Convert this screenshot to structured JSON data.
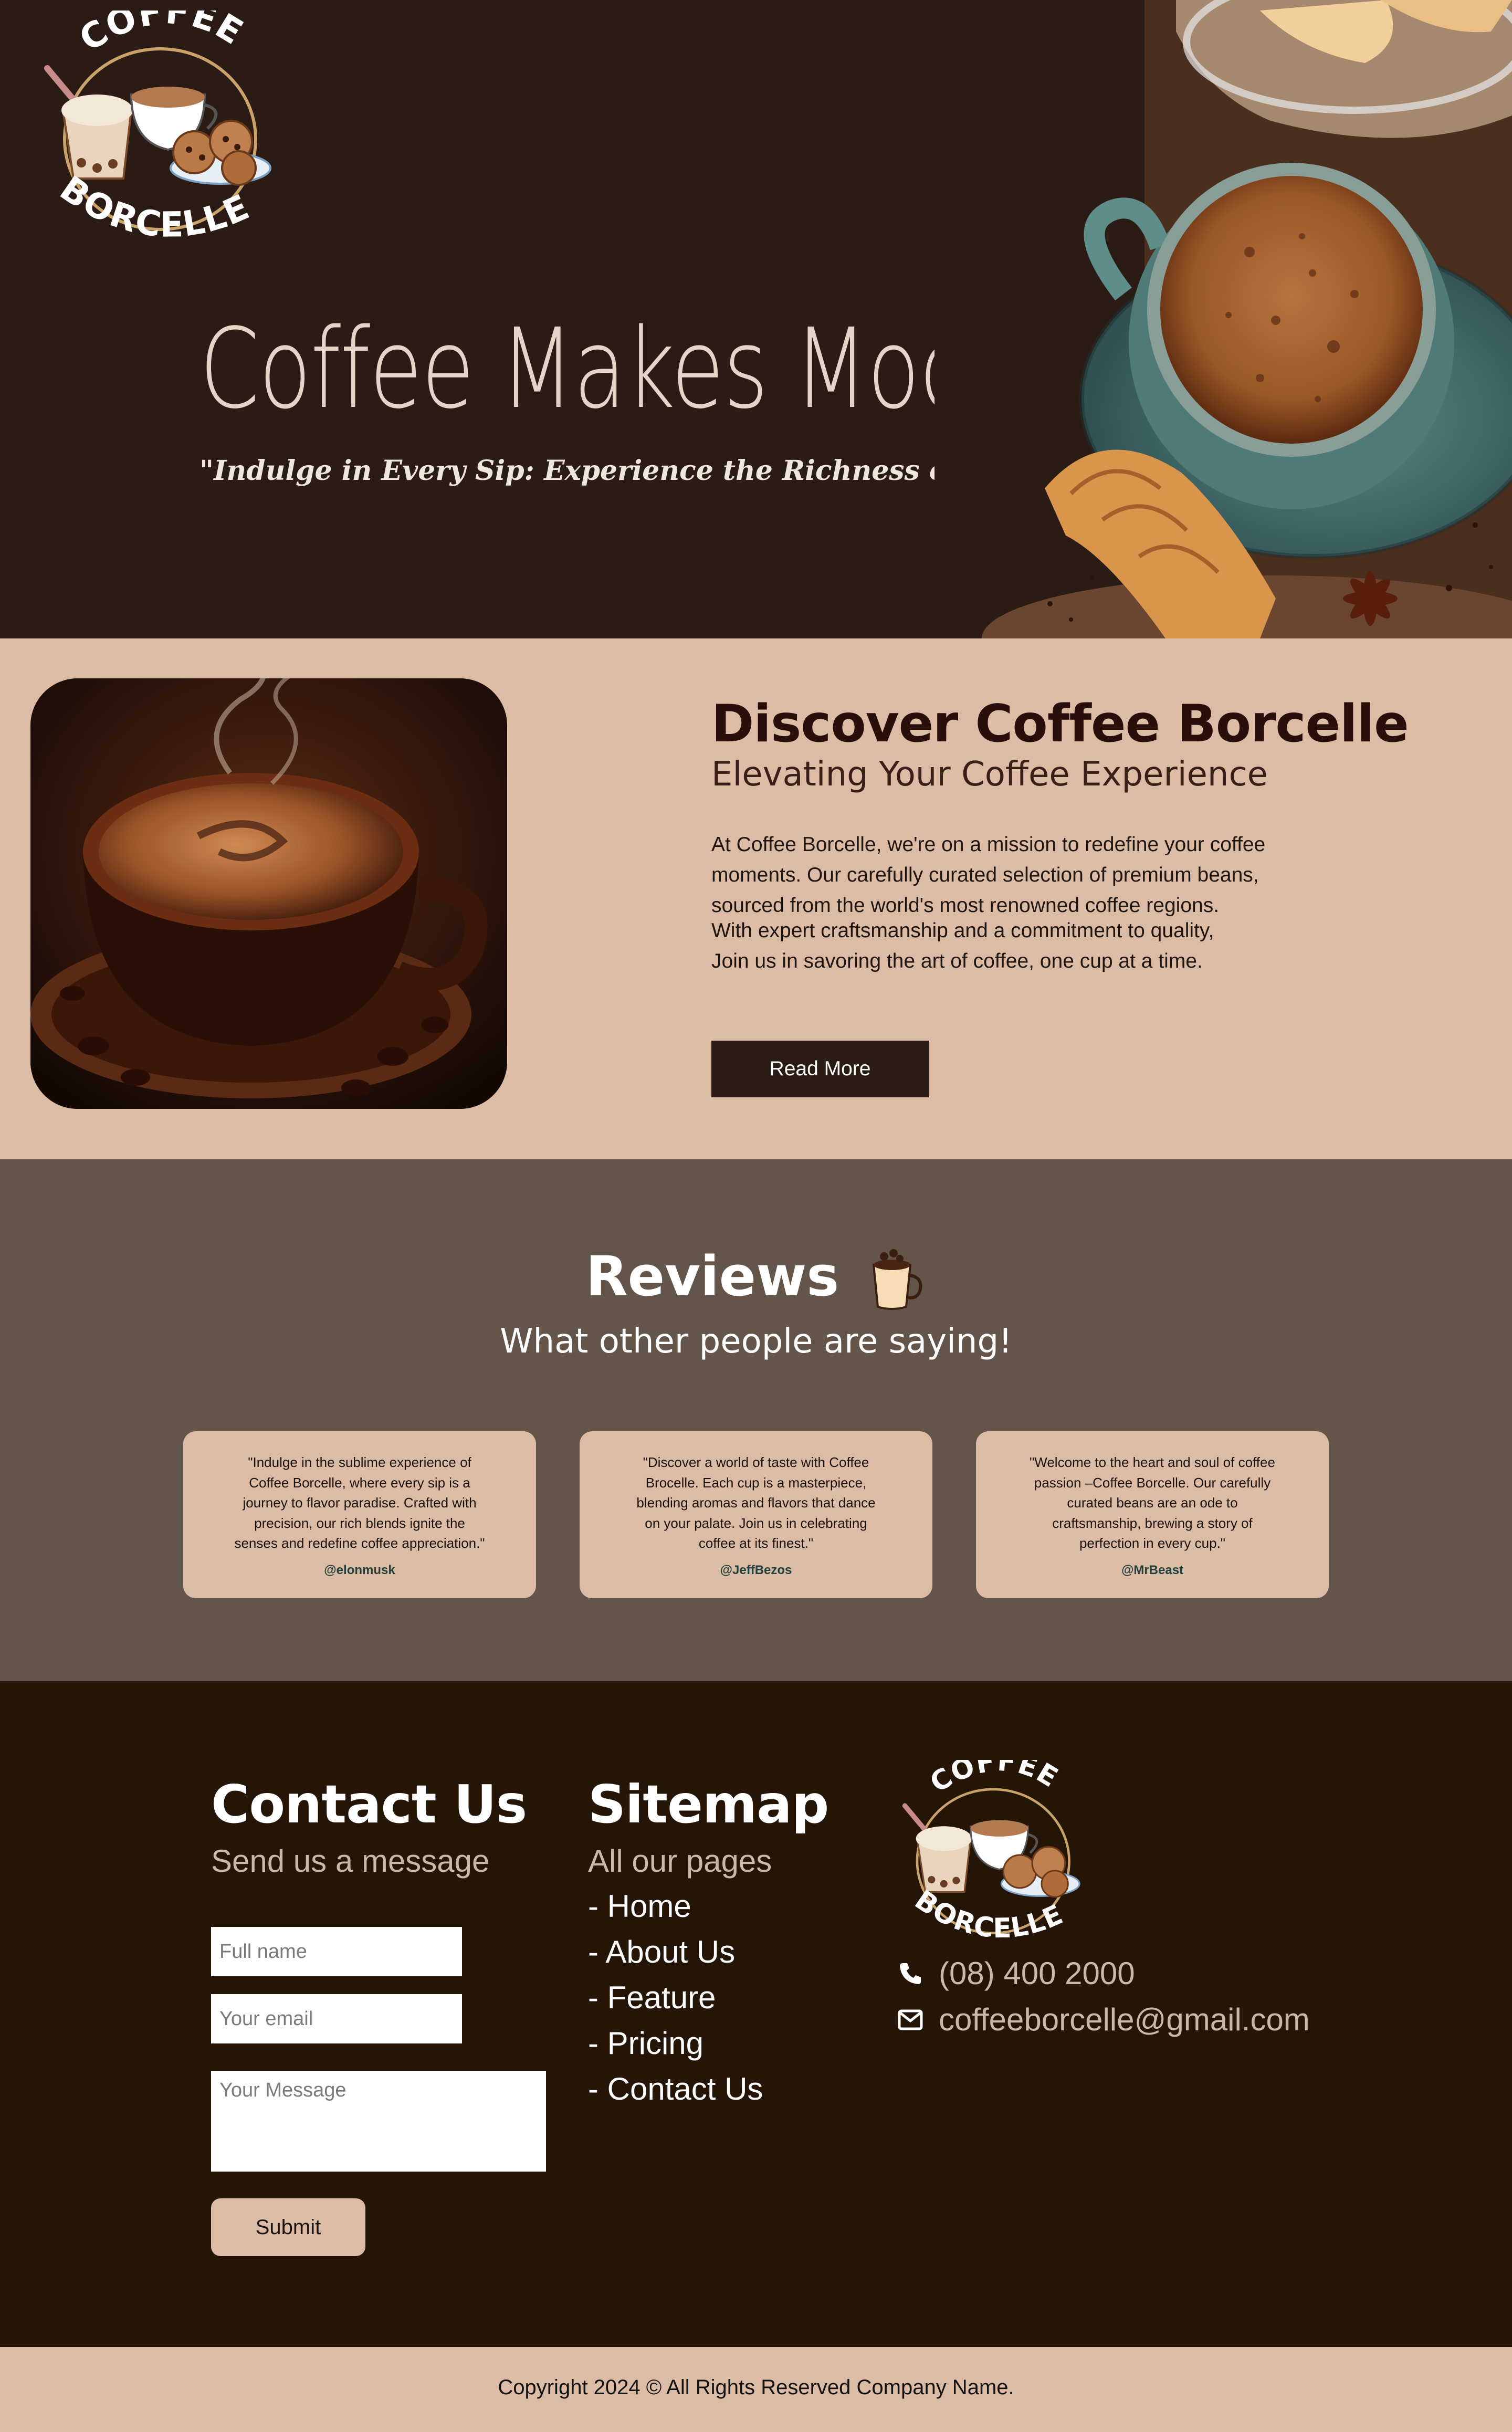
{
  "brand": {
    "logo_top": "COFFEE",
    "logo_bottom": "BORCELLE"
  },
  "hero": {
    "title": "Coffee Makes Mood",
    "subtitle": "\"Indulge in Every Sip: Experience the Richness of Coffee!\""
  },
  "about": {
    "title": "Discover Coffee Borcelle",
    "subtitle": "Elevating Your Coffee Experience",
    "para1_line1": "At Coffee Borcelle, we're on a mission to redefine your coffee",
    "para1_line2": "moments. Our carefully curated selection of premium beans,",
    "para1_line3": "sourced from the world's most renowned coffee regions.",
    "para2_line1": "With expert craftsmanship and a commitment to quality,",
    "para2_line2": "Join us in savoring the art of coffee, one cup at a time.",
    "button": "Read More"
  },
  "reviews": {
    "title": "Reviews",
    "subtitle": "What other people are saying!",
    "items": [
      {
        "lines": [
          "\"Indulge in the sublime experience of",
          "Coffee Borcelle, where every sip is a",
          "journey to flavor paradise. Crafted with",
          "precision, our rich blends ignite the",
          "senses and redefine coffee appreciation.\""
        ],
        "author": "@elonmusk"
      },
      {
        "lines": [
          "\"Discover a world of taste with Coffee",
          "Brocelle. Each cup is a masterpiece,",
          "blending aromas and flavors that dance",
          "on your palate. Join us in celebrating",
          "coffee at its finest.\""
        ],
        "author": "@JeffBezos"
      },
      {
        "lines": [
          "\"Welcome to the heart and soul of coffee",
          "passion –Coffee Borcelle. Our carefully",
          "curated beans are an ode to",
          "craftsmanship, brewing a story of",
          "perfection in every cup.\""
        ],
        "author": "@MrBeast"
      }
    ]
  },
  "contact": {
    "title": "Contact Us",
    "subtitle": "Send us a message",
    "name_placeholder": "Full name",
    "email_placeholder": "Your email",
    "message_placeholder": "Your Message",
    "submit": "Submit"
  },
  "sitemap": {
    "title": "Sitemap",
    "subtitle": "All our pages",
    "links": [
      "- Home",
      "- About Us",
      "- Feature",
      "- Pricing",
      "- Contact Us"
    ]
  },
  "info": {
    "phone": "(08) 400 2000",
    "email": "coffeeborcelle@gmail.com",
    "phone_icon": "phone-icon",
    "email_icon": "envelope-icon"
  },
  "copyright": "Copyright 2024 © All Rights Reserved Company Name.",
  "colors": {
    "hero_bg": "#2b1b15",
    "about_bg": "#dcbca4",
    "reviews_bg": "#64554b",
    "footer_bg": "#251507",
    "accent_dark": "#2a0e0a"
  }
}
